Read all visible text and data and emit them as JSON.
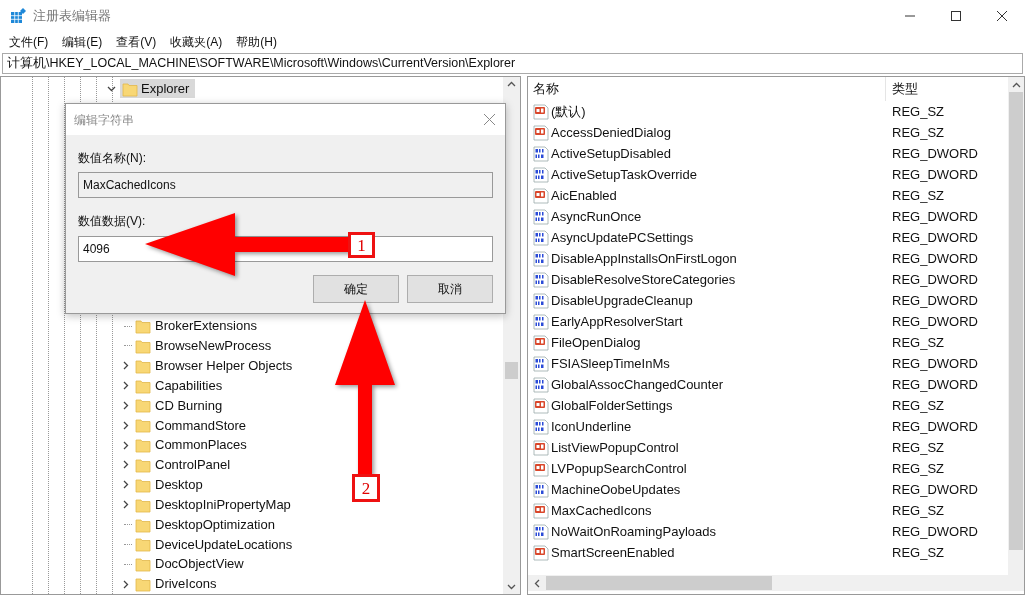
{
  "window": {
    "title": "注册表编辑器"
  },
  "menu": [
    "文件(F)",
    "编辑(E)",
    "查看(V)",
    "收藏夹(A)",
    "帮助(H)"
  ],
  "address": "计算机\\HKEY_LOCAL_MACHINE\\SOFTWARE\\Microsoft\\Windows\\CurrentVersion\\Explorer",
  "tree": {
    "parent": {
      "label": "Explorer",
      "expanded": true,
      "selected": true
    },
    "children": [
      {
        "label": "BrokerExtensions",
        "kind": "leaf"
      },
      {
        "label": "BrowseNewProcess",
        "kind": "leaf"
      },
      {
        "label": "Browser Helper Objects",
        "kind": "branch"
      },
      {
        "label": "Capabilities",
        "kind": "branch"
      },
      {
        "label": "CD Burning",
        "kind": "branch"
      },
      {
        "label": "CommandStore",
        "kind": "branch"
      },
      {
        "label": "CommonPlaces",
        "kind": "branch"
      },
      {
        "label": "ControlPanel",
        "kind": "branch"
      },
      {
        "label": "Desktop",
        "kind": "branch"
      },
      {
        "label": "DesktopIniPropertyMap",
        "kind": "branch"
      },
      {
        "label": "DesktopOptimization",
        "kind": "leaf"
      },
      {
        "label": "DeviceUpdateLocations",
        "kind": "leaf"
      },
      {
        "label": "DocObjectView",
        "kind": "leaf"
      },
      {
        "label": "DriveIcons",
        "kind": "branch"
      }
    ]
  },
  "values": {
    "columns": [
      "名称",
      "类型"
    ],
    "rows": [
      {
        "name": "(默认)",
        "type": "REG_SZ",
        "kind": "string"
      },
      {
        "name": "AccessDeniedDialog",
        "type": "REG_SZ",
        "kind": "string"
      },
      {
        "name": "ActiveSetupDisabled",
        "type": "REG_DWORD",
        "kind": "dword"
      },
      {
        "name": "ActiveSetupTaskOverride",
        "type": "REG_DWORD",
        "kind": "dword"
      },
      {
        "name": "AicEnabled",
        "type": "REG_SZ",
        "kind": "string"
      },
      {
        "name": "AsyncRunOnce",
        "type": "REG_DWORD",
        "kind": "dword"
      },
      {
        "name": "AsyncUpdatePCSettings",
        "type": "REG_DWORD",
        "kind": "dword"
      },
      {
        "name": "DisableAppInstallsOnFirstLogon",
        "type": "REG_DWORD",
        "kind": "dword"
      },
      {
        "name": "DisableResolveStoreCategories",
        "type": "REG_DWORD",
        "kind": "dword"
      },
      {
        "name": "DisableUpgradeCleanup",
        "type": "REG_DWORD",
        "kind": "dword"
      },
      {
        "name": "EarlyAppResolverStart",
        "type": "REG_DWORD",
        "kind": "dword"
      },
      {
        "name": "FileOpenDialog",
        "type": "REG_SZ",
        "kind": "string"
      },
      {
        "name": "FSIASleepTimeInMs",
        "type": "REG_DWORD",
        "kind": "dword"
      },
      {
        "name": "GlobalAssocChangedCounter",
        "type": "REG_DWORD",
        "kind": "dword"
      },
      {
        "name": "GlobalFolderSettings",
        "type": "REG_SZ",
        "kind": "string"
      },
      {
        "name": "IconUnderline",
        "type": "REG_DWORD",
        "kind": "dword"
      },
      {
        "name": "ListViewPopupControl",
        "type": "REG_SZ",
        "kind": "string"
      },
      {
        "name": "LVPopupSearchControl",
        "type": "REG_SZ",
        "kind": "string"
      },
      {
        "name": "MachineOobeUpdates",
        "type": "REG_DWORD",
        "kind": "dword"
      },
      {
        "name": "MaxCachedIcons",
        "type": "REG_SZ",
        "kind": "string"
      },
      {
        "name": "NoWaitOnRoamingPayloads",
        "type": "REG_DWORD",
        "kind": "dword"
      },
      {
        "name": "SmartScreenEnabled",
        "type": "REG_SZ",
        "kind": "string"
      }
    ]
  },
  "dialog": {
    "title": "编辑字符串",
    "name_label": "数值名称(N):",
    "name_value": "MaxCachedIcons",
    "data_label": "数值数据(V):",
    "data_value": "4096",
    "buttons": [
      "确定",
      "取消"
    ]
  },
  "annotations": [
    {
      "label": "1"
    },
    {
      "label": "2"
    }
  ]
}
